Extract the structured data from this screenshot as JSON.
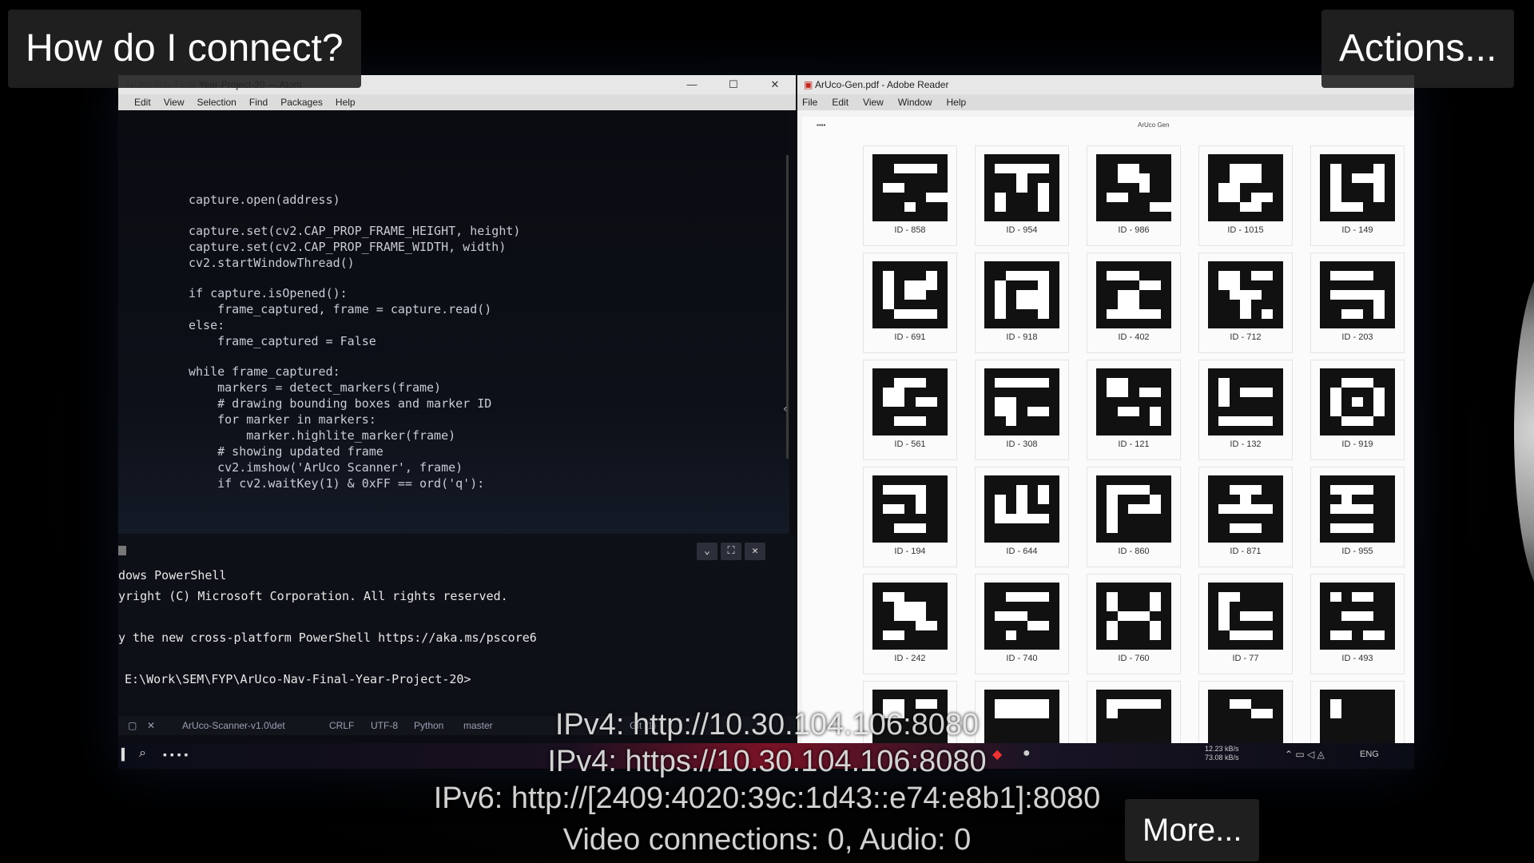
{
  "overlay": {
    "help_button": "How do I connect?",
    "actions_button": "Actions...",
    "more_button": "More...",
    "ipv4_http": "IPv4: http://10.30.104.106:8080",
    "ipv4_https": "IPv4: https://10.30.104.106:8080",
    "ipv6_http": "IPv6: http://[2409:4020:39c:1d43::e74:e8b1]:8080",
    "connections": "Video connections: 0, Audio: 0"
  },
  "atom": {
    "title": "Year-Project-20 — Atom",
    "menu": [
      "Edit",
      "View",
      "Selection",
      "Find",
      "Packages",
      "Help"
    ],
    "code_lines": [
      {
        "t": "capture.open(address)"
      },
      {
        "t": "capture.set(cv2.CAP_PROP_FRAME_HEIGHT, height)"
      },
      {
        "t": "capture.set(cv2.CAP_PROP_FRAME_WIDTH, width)"
      },
      {
        "t": "cv2.startWindowThread()"
      },
      {
        "t": "if capture.isOpened():"
      },
      {
        "t": "    frame_captured, frame = capture.read()"
      },
      {
        "t": "else:"
      },
      {
        "t": "    frame_captured = False"
      },
      {
        "t": "while frame_captured:"
      },
      {
        "t": "    markers = detect_markers(frame)"
      },
      {
        "t": "    # drawing bounding boxes and marker ID"
      },
      {
        "t": "    for marker in markers:"
      },
      {
        "t": "        marker.highlite_marker(frame)"
      },
      {
        "t": "    # showing updated frame"
      },
      {
        "t": "    cv2.imshow('ArUco Scanner', frame)"
      },
      {
        "t": "    if cv2.waitKey(1) & 0xFF == ord('q'):"
      }
    ],
    "terminal_lines": [
      "dows PowerShell",
      "yright (C) Microsoft Corporation. All rights reserved.",
      "y the new cross-platform PowerShell https://aka.ms/pscore6",
      "E:\\Work\\SEM\\FYP\\ArUco-Nav-Final-Year-Project-20>"
    ],
    "status": {
      "file": "ArUco-Scanner-v1.0\\det",
      "eol": "CRLF",
      "encoding": "UTF-8",
      "grammar": "Python",
      "branch": "master",
      "git": "Git (1)"
    }
  },
  "adobe": {
    "title": "ArUco-Gen.pdf - Adobe Reader",
    "menu": [
      "File",
      "Edit",
      "View",
      "Window",
      "Help"
    ],
    "page_header": "ArUco Gen",
    "markers": [
      "ID - 858",
      "ID - 954",
      "ID - 986",
      "ID - 1015",
      "ID - 149",
      "ID - 691",
      "ID - 918",
      "ID - 402",
      "ID - 712",
      "ID - 203",
      "ID - 561",
      "ID - 308",
      "ID - 121",
      "ID - 132",
      "ID - 919",
      "ID - 194",
      "ID - 644",
      "ID - 860",
      "ID - 871",
      "ID - 955",
      "ID - 242",
      "ID - 740",
      "ID - 760",
      "ID - 77",
      "ID - 493",
      "",
      "",
      "",
      "",
      ""
    ]
  },
  "taskbar": {
    "lang": "ENG",
    "net_up": "12.23 kB/s",
    "net_down": "73.08 kB/s"
  }
}
